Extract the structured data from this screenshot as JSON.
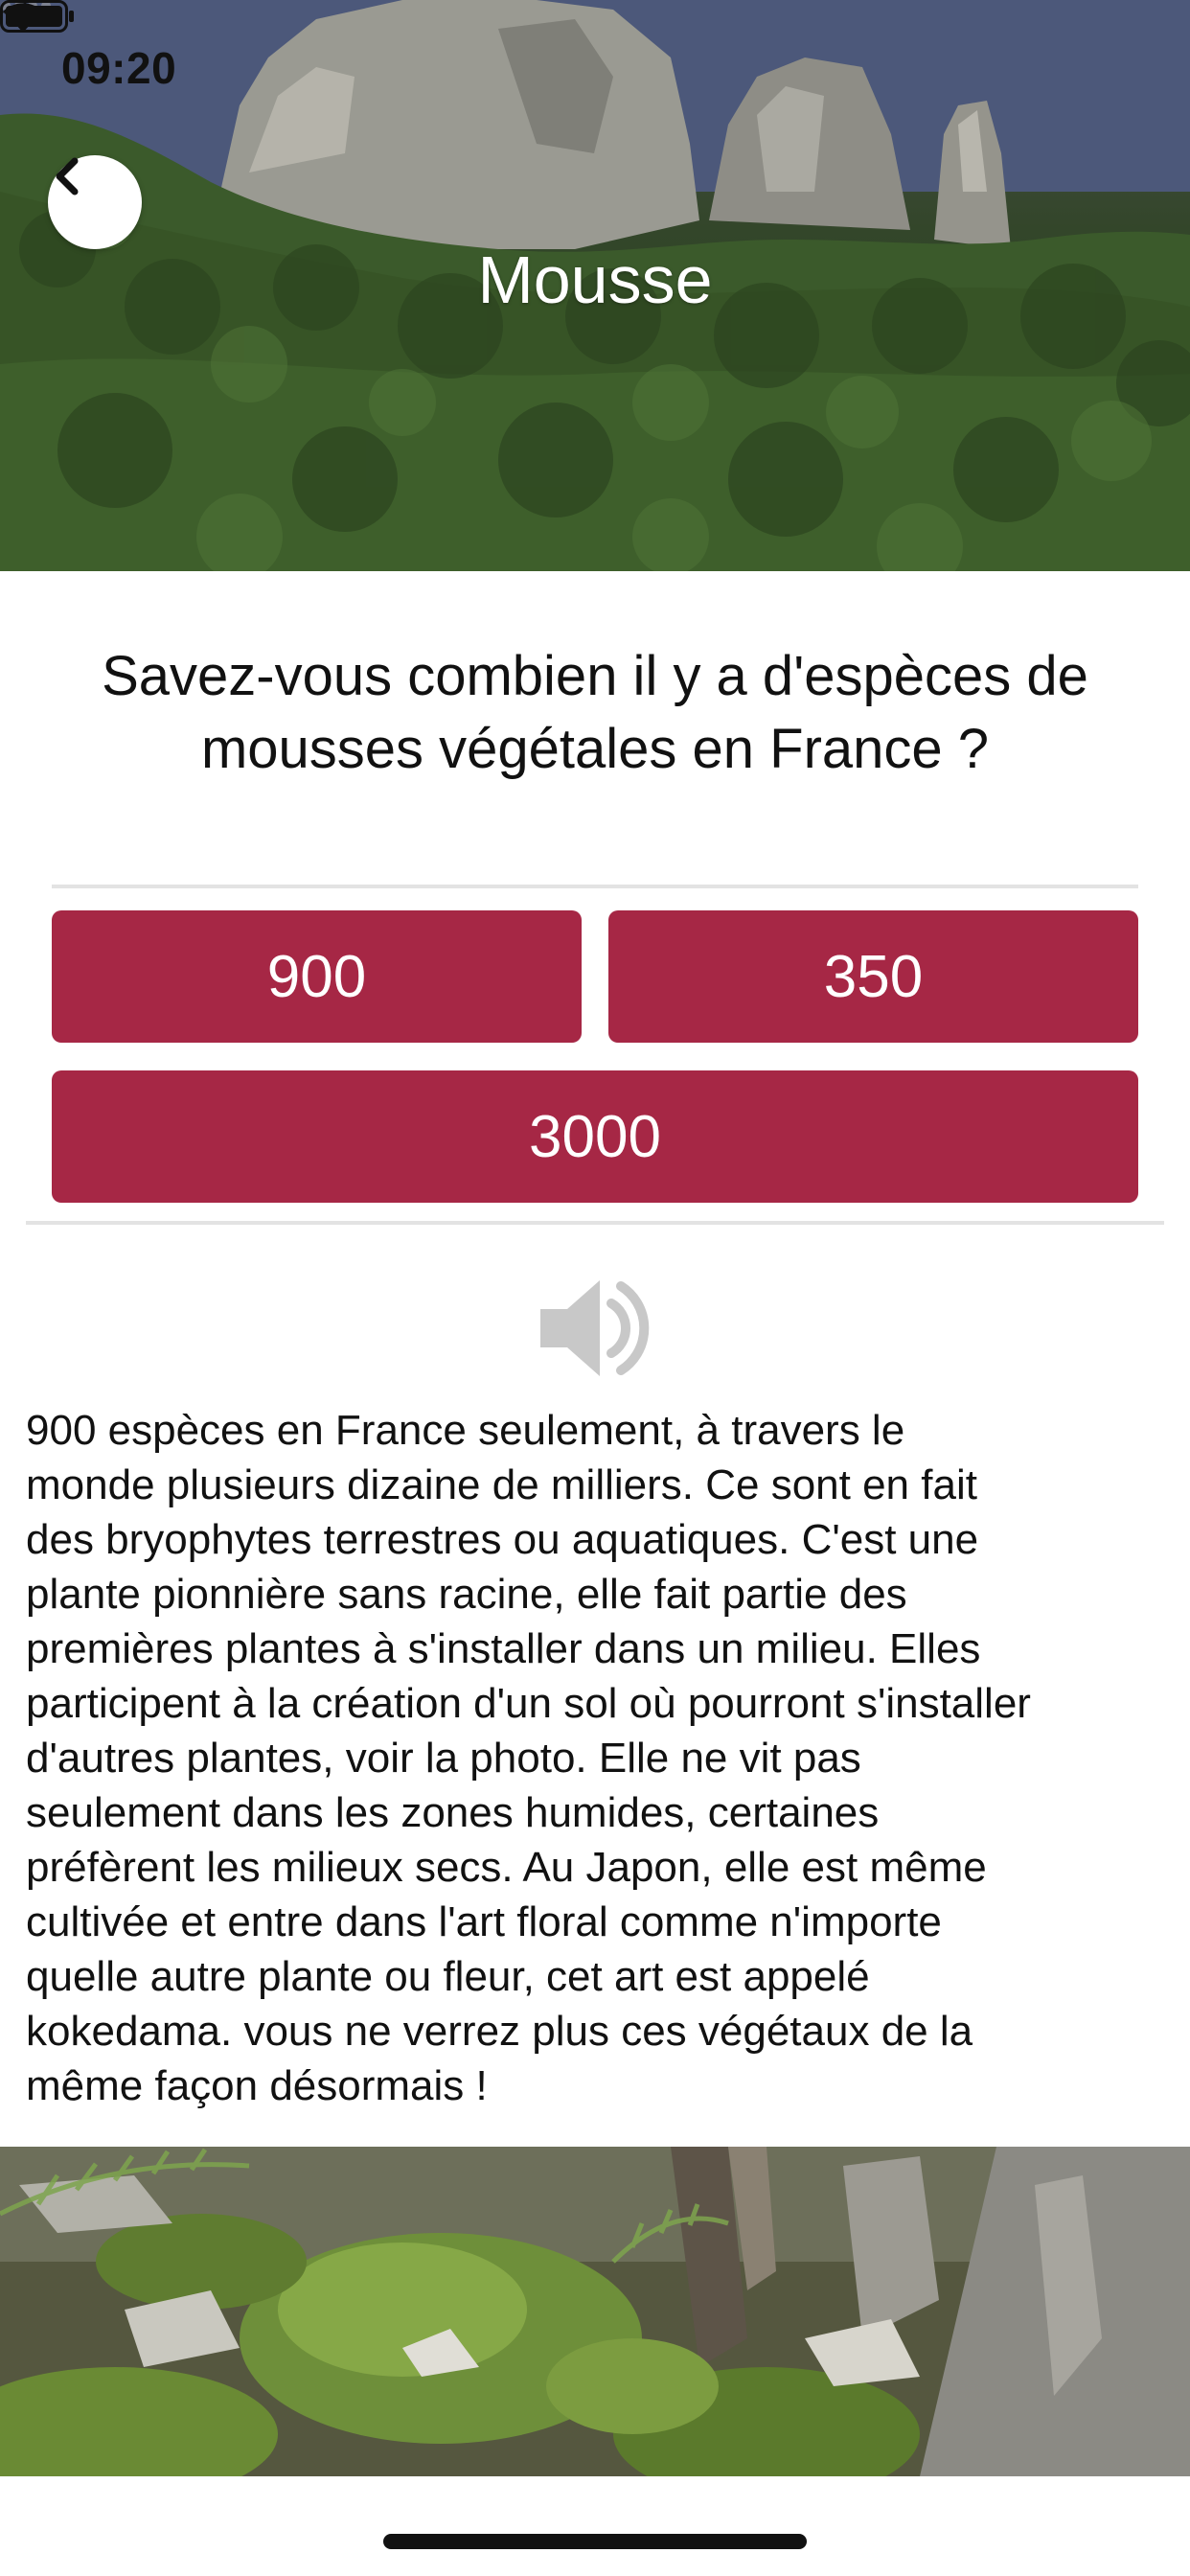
{
  "status_bar": {
    "time": "09:20",
    "icons": [
      "location-arrow-icon",
      "signal-icon",
      "wifi-icon",
      "battery-icon"
    ]
  },
  "header": {
    "title": "Mousse",
    "back_icon": "chevron-left-icon",
    "image": "cliffs-forest-photo"
  },
  "question": {
    "text": "Savez-vous combien il y a d'espèces de mousses végétales en France ?"
  },
  "answers": {
    "option_1": "900",
    "option_2": "350",
    "option_3": "3000"
  },
  "explanation": {
    "audio_icon": "speaker-icon",
    "text": "900 espèces en France seulement, à travers le\nmonde plusieurs dizaine de milliers. Ce sont en fait\ndes bryophytes terrestres ou aquatiques.  C'est une\nplante pionnière sans racine, elle fait partie des\npremières plantes à s'installer dans un milieu. Elles\nparticipent à la création d'un sol où pourront s'installer\nd'autres plantes, voir la photo. Elle ne vit pas\nseulement dans les zones humides, certaines\npréfèrent les milieux secs. Au Japon, elle est même\ncultivée et entre dans l'art floral comme n'importe\nquelle autre plante ou fleur, cet art est appelé\nkokedama. vous ne verrez plus ces végétaux de la\nmême façon désormais !"
  },
  "bottom": {
    "image": "moss-rocks-photo"
  },
  "colors": {
    "answer_button": "#a62745",
    "divider": "#e3e3e3"
  }
}
